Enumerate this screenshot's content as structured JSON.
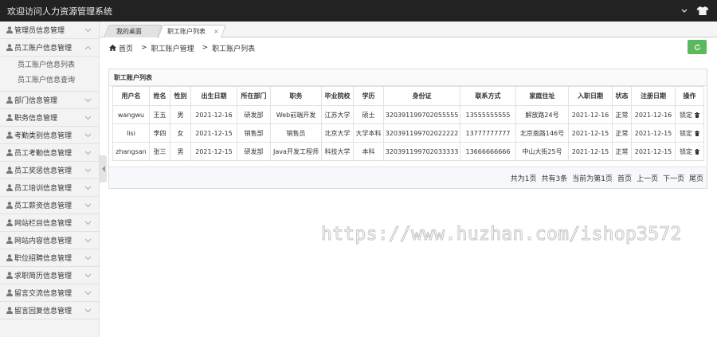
{
  "app": {
    "title": "欢迎访问人力资源管理系统"
  },
  "sidebar": {
    "items": [
      {
        "label": "管理员信息管理"
      },
      {
        "label": "员工账户信息管理",
        "expanded": true,
        "children": [
          {
            "label": "员工账户信息列表"
          },
          {
            "label": "员工账户信息查询"
          }
        ]
      },
      {
        "label": "部门信息管理"
      },
      {
        "label": "职务信息管理"
      },
      {
        "label": "考勤类别信息管理"
      },
      {
        "label": "员工考勤信息管理"
      },
      {
        "label": "员工奖惩信息管理"
      },
      {
        "label": "员工培训信息管理"
      },
      {
        "label": "员工薪资信息管理"
      },
      {
        "label": "网站栏目信息管理"
      },
      {
        "label": "网站内容信息管理"
      },
      {
        "label": "职位招聘信息管理"
      },
      {
        "label": "求职简历信息管理"
      },
      {
        "label": "留言交流信息管理"
      },
      {
        "label": "留言回复信息管理"
      }
    ]
  },
  "tabs": [
    {
      "label": "我的桌面"
    },
    {
      "label": "职工账户列表",
      "close": "×"
    }
  ],
  "breadcrumb": {
    "home": "首页",
    "sep": ">",
    "level1": "职工账户管理",
    "level2": "职工账户列表"
  },
  "panel": {
    "title": "职工账户列表"
  },
  "table": {
    "headers": [
      "用户名",
      "姓名",
      "性别",
      "出生日期",
      "所在部门",
      "职务",
      "毕业院校",
      "学历",
      "身份证",
      "联系方式",
      "家庭住址",
      "入职日期",
      "状态",
      "注册日期",
      "操作"
    ],
    "rows": [
      [
        "wangwu",
        "王五",
        "男",
        "2021-12-16",
        "研发部",
        "Web前端开发",
        "江苏大学",
        "硕士",
        "320391199702055555",
        "13555555555",
        "解放路24号",
        "2021-12-16",
        "正常",
        "2021-12-16",
        "锁定"
      ],
      [
        "lisi",
        "李四",
        "女",
        "2021-12-15",
        "销售部",
        "销售员",
        "北京大学",
        "大学本科",
        "320391199702022222",
        "13777777777",
        "北京南路146号",
        "2021-12-15",
        "正常",
        "2021-12-15",
        "锁定"
      ],
      [
        "zhangsan",
        "张三",
        "男",
        "2021-12-15",
        "研发部",
        "Java开发工程师",
        "科技大学",
        "本科",
        "320391199702033333",
        "13666666666",
        "中山大街25号",
        "2021-12-15",
        "正常",
        "2021-12-15",
        "锁定"
      ]
    ]
  },
  "pager": {
    "total_pages": "共为1页",
    "total_records": "共有3条",
    "current_page": "当前为第1页",
    "first": "首页",
    "prev": "上一页",
    "next": "下一页",
    "last": "尾页"
  },
  "watermark": "https://www.huzhan.com/ishop3572",
  "colors": {
    "topbar": "#222222",
    "refresh_button": "#5cb85c",
    "sidebar_bg": "#f3f3f3",
    "pager_bg": "#f6f8fb"
  },
  "icons": {
    "user": "user-icon",
    "chevron": "chevron-icon",
    "home": "home-icon",
    "refresh": "refresh-icon",
    "delete": "trash-icon",
    "topbar_dropdown": "chevron-down-icon",
    "topbar_theme": "shirt-icon"
  }
}
